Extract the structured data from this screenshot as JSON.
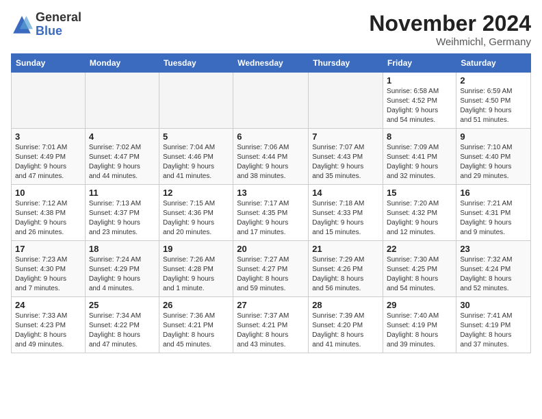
{
  "logo": {
    "general": "General",
    "blue": "Blue"
  },
  "title": "November 2024",
  "location": "Weihmichl, Germany",
  "headers": [
    "Sunday",
    "Monday",
    "Tuesday",
    "Wednesday",
    "Thursday",
    "Friday",
    "Saturday"
  ],
  "weeks": [
    [
      {
        "day": "",
        "info": ""
      },
      {
        "day": "",
        "info": ""
      },
      {
        "day": "",
        "info": ""
      },
      {
        "day": "",
        "info": ""
      },
      {
        "day": "",
        "info": ""
      },
      {
        "day": "1",
        "info": "Sunrise: 6:58 AM\nSunset: 4:52 PM\nDaylight: 9 hours\nand 54 minutes."
      },
      {
        "day": "2",
        "info": "Sunrise: 6:59 AM\nSunset: 4:50 PM\nDaylight: 9 hours\nand 51 minutes."
      }
    ],
    [
      {
        "day": "3",
        "info": "Sunrise: 7:01 AM\nSunset: 4:49 PM\nDaylight: 9 hours\nand 47 minutes."
      },
      {
        "day": "4",
        "info": "Sunrise: 7:02 AM\nSunset: 4:47 PM\nDaylight: 9 hours\nand 44 minutes."
      },
      {
        "day": "5",
        "info": "Sunrise: 7:04 AM\nSunset: 4:46 PM\nDaylight: 9 hours\nand 41 minutes."
      },
      {
        "day": "6",
        "info": "Sunrise: 7:06 AM\nSunset: 4:44 PM\nDaylight: 9 hours\nand 38 minutes."
      },
      {
        "day": "7",
        "info": "Sunrise: 7:07 AM\nSunset: 4:43 PM\nDaylight: 9 hours\nand 35 minutes."
      },
      {
        "day": "8",
        "info": "Sunrise: 7:09 AM\nSunset: 4:41 PM\nDaylight: 9 hours\nand 32 minutes."
      },
      {
        "day": "9",
        "info": "Sunrise: 7:10 AM\nSunset: 4:40 PM\nDaylight: 9 hours\nand 29 minutes."
      }
    ],
    [
      {
        "day": "10",
        "info": "Sunrise: 7:12 AM\nSunset: 4:38 PM\nDaylight: 9 hours\nand 26 minutes."
      },
      {
        "day": "11",
        "info": "Sunrise: 7:13 AM\nSunset: 4:37 PM\nDaylight: 9 hours\nand 23 minutes."
      },
      {
        "day": "12",
        "info": "Sunrise: 7:15 AM\nSunset: 4:36 PM\nDaylight: 9 hours\nand 20 minutes."
      },
      {
        "day": "13",
        "info": "Sunrise: 7:17 AM\nSunset: 4:35 PM\nDaylight: 9 hours\nand 17 minutes."
      },
      {
        "day": "14",
        "info": "Sunrise: 7:18 AM\nSunset: 4:33 PM\nDaylight: 9 hours\nand 15 minutes."
      },
      {
        "day": "15",
        "info": "Sunrise: 7:20 AM\nSunset: 4:32 PM\nDaylight: 9 hours\nand 12 minutes."
      },
      {
        "day": "16",
        "info": "Sunrise: 7:21 AM\nSunset: 4:31 PM\nDaylight: 9 hours\nand 9 minutes."
      }
    ],
    [
      {
        "day": "17",
        "info": "Sunrise: 7:23 AM\nSunset: 4:30 PM\nDaylight: 9 hours\nand 7 minutes."
      },
      {
        "day": "18",
        "info": "Sunrise: 7:24 AM\nSunset: 4:29 PM\nDaylight: 9 hours\nand 4 minutes."
      },
      {
        "day": "19",
        "info": "Sunrise: 7:26 AM\nSunset: 4:28 PM\nDaylight: 9 hours\nand 1 minute."
      },
      {
        "day": "20",
        "info": "Sunrise: 7:27 AM\nSunset: 4:27 PM\nDaylight: 8 hours\nand 59 minutes."
      },
      {
        "day": "21",
        "info": "Sunrise: 7:29 AM\nSunset: 4:26 PM\nDaylight: 8 hours\nand 56 minutes."
      },
      {
        "day": "22",
        "info": "Sunrise: 7:30 AM\nSunset: 4:25 PM\nDaylight: 8 hours\nand 54 minutes."
      },
      {
        "day": "23",
        "info": "Sunrise: 7:32 AM\nSunset: 4:24 PM\nDaylight: 8 hours\nand 52 minutes."
      }
    ],
    [
      {
        "day": "24",
        "info": "Sunrise: 7:33 AM\nSunset: 4:23 PM\nDaylight: 8 hours\nand 49 minutes."
      },
      {
        "day": "25",
        "info": "Sunrise: 7:34 AM\nSunset: 4:22 PM\nDaylight: 8 hours\nand 47 minutes."
      },
      {
        "day": "26",
        "info": "Sunrise: 7:36 AM\nSunset: 4:21 PM\nDaylight: 8 hours\nand 45 minutes."
      },
      {
        "day": "27",
        "info": "Sunrise: 7:37 AM\nSunset: 4:21 PM\nDaylight: 8 hours\nand 43 minutes."
      },
      {
        "day": "28",
        "info": "Sunrise: 7:39 AM\nSunset: 4:20 PM\nDaylight: 8 hours\nand 41 minutes."
      },
      {
        "day": "29",
        "info": "Sunrise: 7:40 AM\nSunset: 4:19 PM\nDaylight: 8 hours\nand 39 minutes."
      },
      {
        "day": "30",
        "info": "Sunrise: 7:41 AM\nSunset: 4:19 PM\nDaylight: 8 hours\nand 37 minutes."
      }
    ]
  ]
}
